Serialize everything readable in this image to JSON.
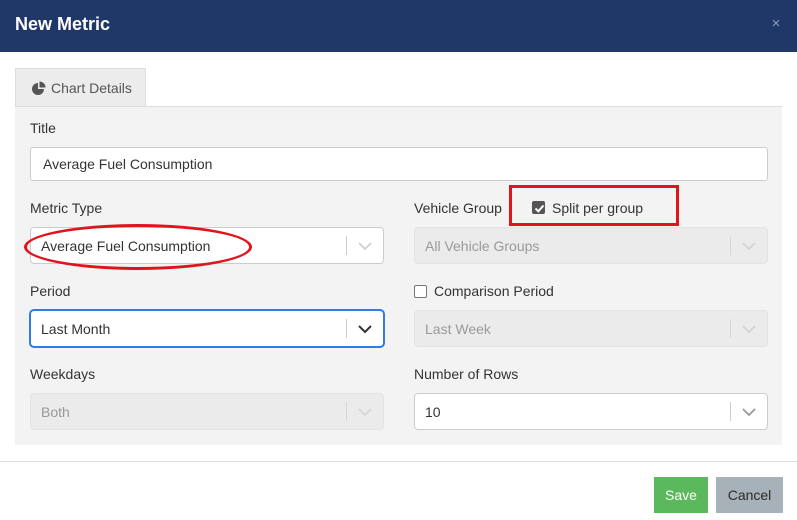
{
  "header": {
    "title": "New Metric",
    "close_symbol": "×"
  },
  "tabs": [
    {
      "label": "Chart Details",
      "icon": "pie-chart-icon",
      "active": true
    }
  ],
  "form": {
    "title": {
      "label": "Title",
      "value": "Average Fuel Consumption"
    },
    "metric_type": {
      "label": "Metric Type",
      "value": "Average Fuel Consumption"
    },
    "vehicle_group": {
      "label": "Vehicle Group",
      "value": "All Vehicle Groups",
      "disabled": true,
      "split_label": "Split per group",
      "split_checked": true
    },
    "period": {
      "label": "Period",
      "value": "Last Month"
    },
    "comparison": {
      "label": "Comparison Period",
      "checked": false,
      "value": "Last Week",
      "disabled": true
    },
    "weekdays": {
      "label": "Weekdays",
      "value": "Both",
      "disabled": true
    },
    "rows": {
      "label": "Number of Rows",
      "value": "10"
    }
  },
  "footer": {
    "save_label": "Save",
    "cancel_label": "Cancel"
  },
  "colors": {
    "header_bg": "#1f3868",
    "save_bg": "#5cb85c",
    "cancel_bg": "#a6b1ba",
    "annotation": "#e0141c",
    "focus": "#2f7de1"
  }
}
